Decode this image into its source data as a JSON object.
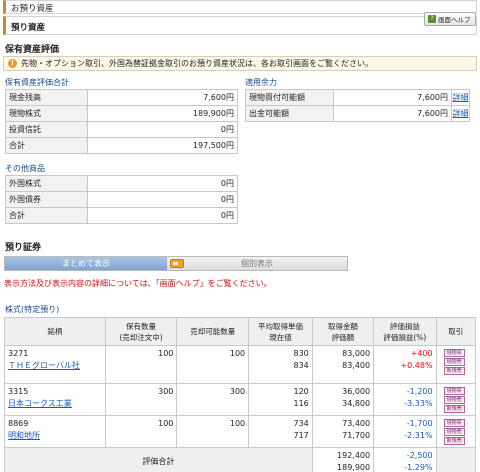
{
  "breadcrumb": "お預り資産",
  "page_title": "預り資産",
  "help_button": "画面ヘルプ",
  "asset_section_title": "保有資産評価",
  "notice_text": "先物・オプション取引、外国為替証拠金取引のお預り資産状況は、各お取引画面をご覧ください。",
  "eval_summary": {
    "label": "保有資産評価合計",
    "rows": [
      {
        "k": "現金残高",
        "v": "7,600円"
      },
      {
        "k": "現物株式",
        "v": "189,900円"
      },
      {
        "k": "投資信託",
        "v": "0円"
      },
      {
        "k": "合計",
        "v": "197,500円"
      }
    ]
  },
  "buying_power": {
    "label": "適用余力",
    "rows": [
      {
        "k": "現物買付可能額",
        "v": "7,600円",
        "link": "詳細"
      },
      {
        "k": "出金可能額",
        "v": "7,600円",
        "link": "詳細"
      }
    ]
  },
  "other_products": {
    "label": "その他商品",
    "rows": [
      {
        "k": "外国株式",
        "v": "0円"
      },
      {
        "k": "外国債券",
        "v": "0円"
      },
      {
        "k": "合計",
        "v": "0円"
      }
    ]
  },
  "securities_title": "預り証券",
  "view_toggle": {
    "active": "まとめて表示",
    "inactive": "個別表示"
  },
  "display_warning": "表示方法及び表示内容の詳細については、「画面ヘルプ」をご覧ください。",
  "holdings_label": "株式(特定預り)",
  "table_headers": {
    "name": "銘柄",
    "qty1": "保有数量",
    "qty2": "(売却注文中)",
    "sellable": "売却可能数量",
    "avg1": "平均取得単価",
    "avg2": "現在値",
    "amt1": "取得金額",
    "amt2": "評価額",
    "pl1": "評価損益",
    "pl2": "評価損益(%)",
    "trade": "取引"
  },
  "holdings": [
    {
      "code": "3271",
      "name": "ＴＨＥグローバル社",
      "qty": "100",
      "sellable": "100",
      "avg": "830",
      "price": "834",
      "cost": "83,000",
      "value": "83,400",
      "pl": "+400",
      "pl_pct": "+0.48%"
    },
    {
      "code": "3315",
      "name": "日本コークス工業",
      "qty": "300",
      "sellable": "300",
      "avg": "120",
      "price": "116",
      "cost": "36,000",
      "value": "34,800",
      "pl": "-1,200",
      "pl_pct": "-3.33%"
    },
    {
      "code": "8869",
      "name": "明和地所",
      "qty": "100",
      "sellable": "100",
      "avg": "734",
      "price": "717",
      "cost": "73,400",
      "value": "71,700",
      "pl": "-1,700",
      "pl_pct": "-2.31%"
    }
  ],
  "trade_buttons": [
    "現物買",
    "現物売",
    "新規売"
  ],
  "totals": {
    "label": "評価合計",
    "cost": "192,400",
    "value": "189,900",
    "pl": "-2,500",
    "pl_pct": "-1.29%"
  }
}
